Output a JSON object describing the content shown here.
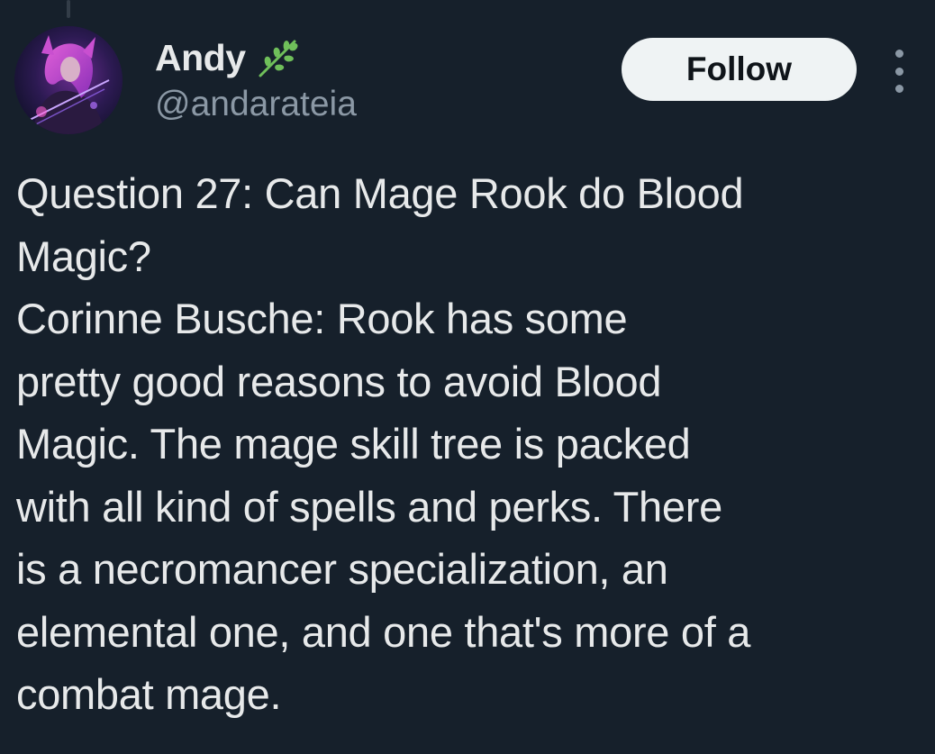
{
  "author": {
    "display_name": "Andy",
    "handle": "@andarateia",
    "badge_icon": "leaf-icon",
    "avatar_icon": "avatar-image"
  },
  "actions": {
    "follow_label": "Follow",
    "more_icon": "more-options-icon"
  },
  "tweet": {
    "lines": [
      "Question 27: Can Mage Rook do Blood",
      "Magic?",
      "Corinne Busche: Rook has some",
      "pretty good reasons to avoid Blood",
      "Magic. The mage skill tree is packed",
      "with all kind of spells and perks. There",
      "is a necromancer specialization, an",
      "elemental one, and one that's more of a",
      "combat mage."
    ]
  },
  "colors": {
    "background": "#16202b",
    "text_primary": "#e7e9ea",
    "text_secondary": "#8b98a5",
    "follow_bg": "#eff3f4",
    "follow_text": "#0f1419",
    "leaf_green": "#6fbf5a"
  }
}
